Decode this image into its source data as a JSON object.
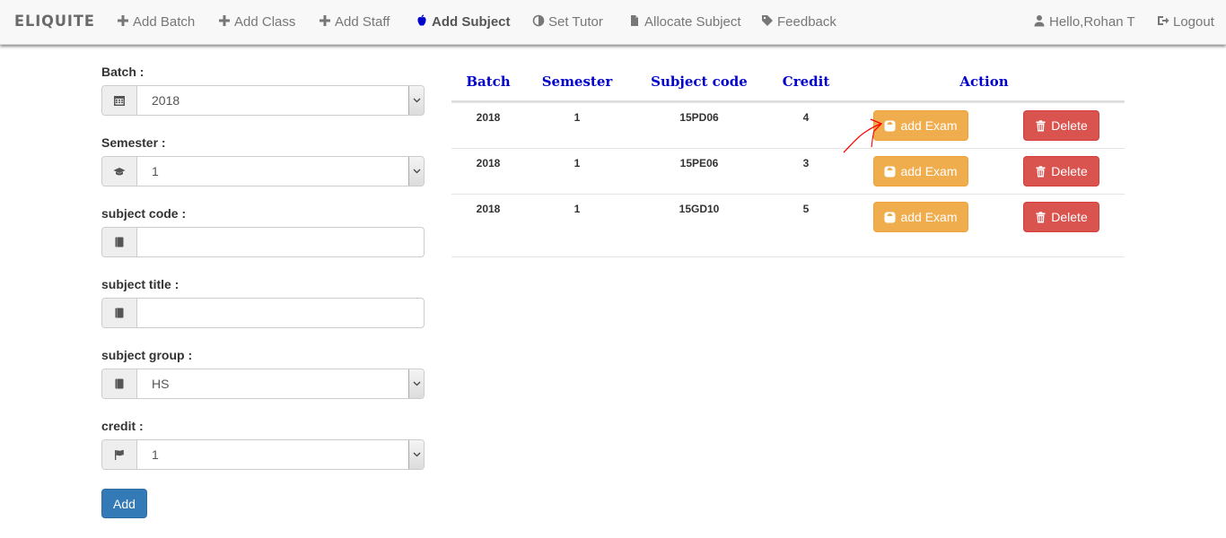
{
  "brand": "ELIQUITE",
  "nav": {
    "add_batch": "Add Batch",
    "add_class": "Add Class",
    "add_staff": "Add Staff",
    "add_subject": "Add Subject",
    "set_tutor": "Set Tutor",
    "allocate_subject": "Allocate Subject",
    "feedback": "Feedback",
    "user": "Hello,Rohan T",
    "logout": "Logout"
  },
  "form": {
    "batch": {
      "label": "Batch :",
      "value": "2018",
      "icon": "calendar-icon"
    },
    "semester": {
      "label": "Semester :",
      "value": "1",
      "icon": "graduation-cap-icon"
    },
    "subject_code": {
      "label": "subject code :",
      "value": "",
      "icon": "book-icon"
    },
    "subject_title": {
      "label": "subject title :",
      "value": "",
      "icon": "book-icon"
    },
    "subject_group": {
      "label": "subject group :",
      "value": "HS",
      "icon": "book-icon"
    },
    "credit": {
      "label": "credit :",
      "value": "1",
      "icon": "flag-icon"
    },
    "add_button": "Add"
  },
  "table": {
    "headers": [
      "Batch",
      "Semester",
      "Subject code",
      "Credit",
      "Action"
    ],
    "rows": [
      {
        "batch": "2018",
        "semester": "1",
        "code": "15PD06",
        "credit": "4"
      },
      {
        "batch": "2018",
        "semester": "1",
        "code": "15PE06",
        "credit": "3"
      },
      {
        "batch": "2018",
        "semester": "1",
        "code": "15GD10",
        "credit": "5"
      }
    ],
    "add_exam_label": "add Exam",
    "delete_label": "Delete"
  },
  "colors": {
    "header_text": "#0000cc",
    "primary": "#337ab7",
    "warning": "#f0ad4e",
    "danger": "#d9534f",
    "annotation": "#ff0000"
  }
}
